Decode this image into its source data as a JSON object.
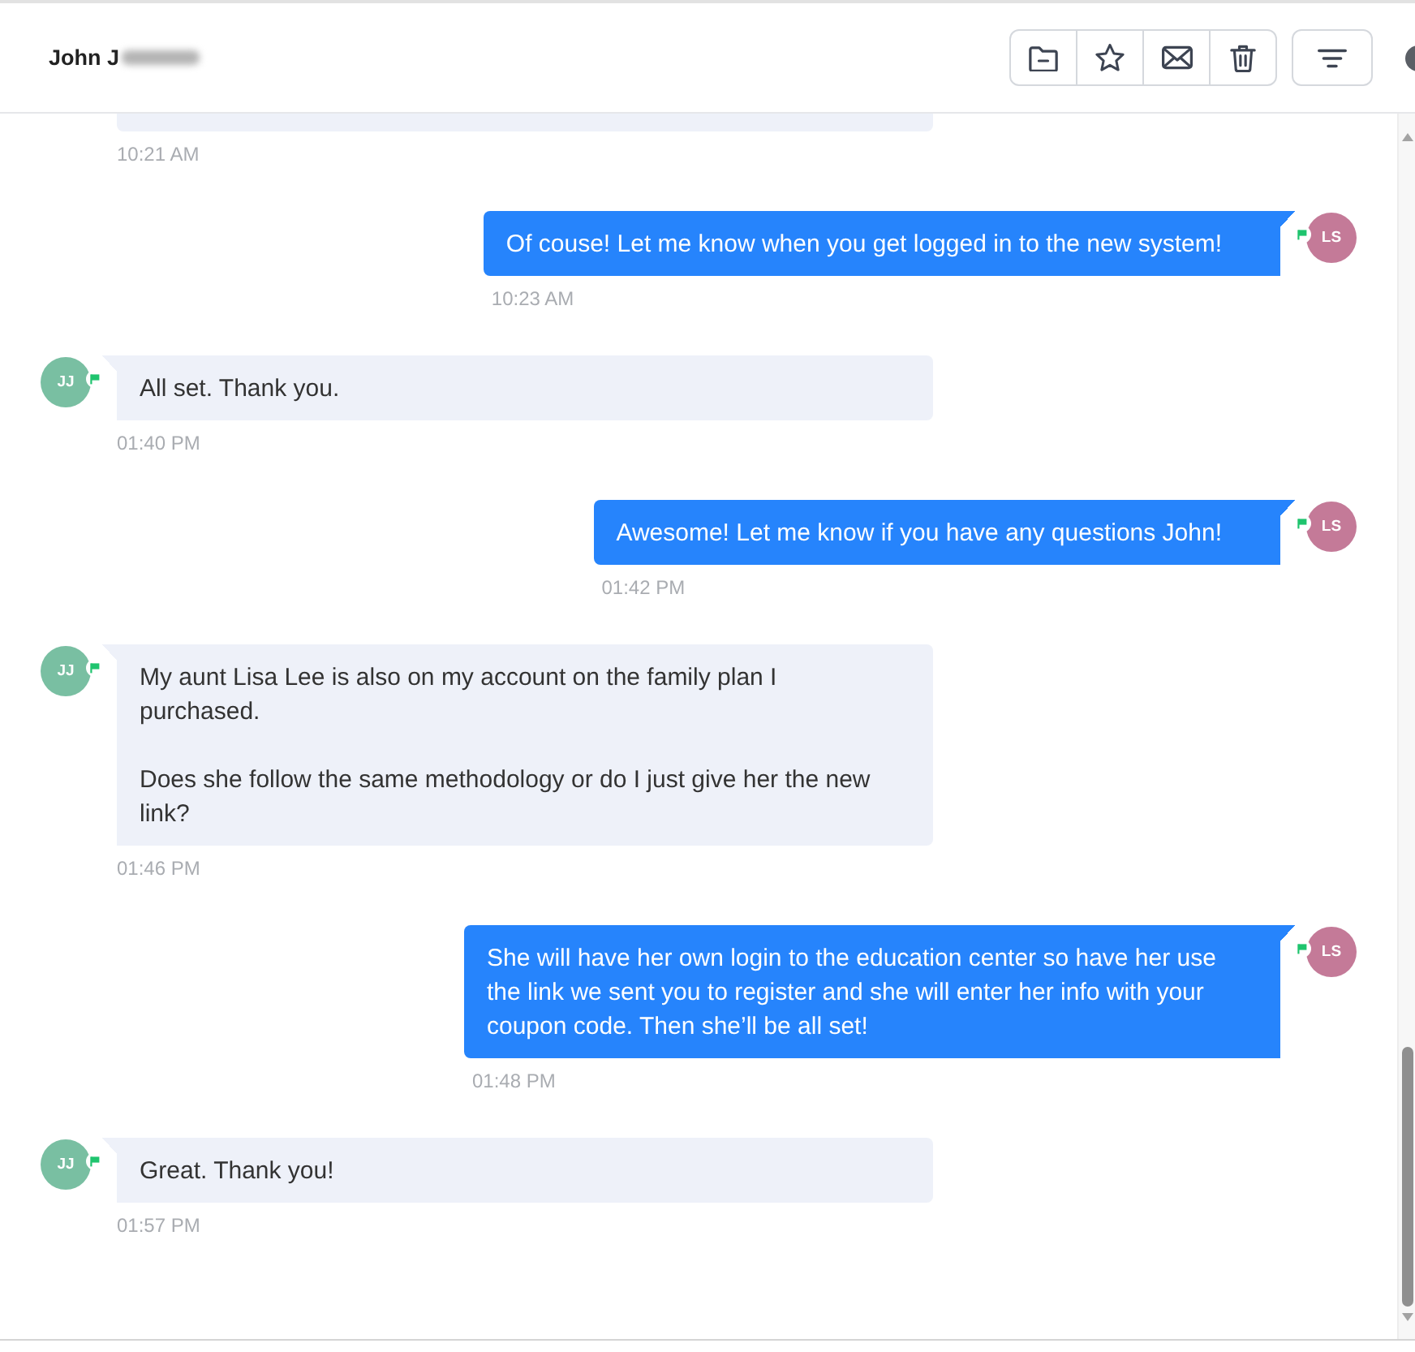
{
  "header": {
    "title": "John J",
    "title_redacted": true
  },
  "messages": [
    {
      "kind": "incoming",
      "partial": true,
      "time": "10:21 AM"
    },
    {
      "kind": "outgoing",
      "partial": false,
      "sender": {
        "initials": "LS",
        "color": "#c47a98",
        "flagged": true
      },
      "paragraphs": [
        "Of couse! Let me know when you get logged in to the new system!"
      ],
      "time": "10:23 AM"
    },
    {
      "kind": "incoming",
      "partial": false,
      "sender": {
        "initials": "JJ",
        "color": "#79bfa2",
        "flagged": true
      },
      "paragraphs": [
        "All set. Thank you."
      ],
      "time": "01:40 PM"
    },
    {
      "kind": "outgoing",
      "partial": false,
      "sender": {
        "initials": "LS",
        "color": "#c47a98",
        "flagged": true
      },
      "paragraphs": [
        "Awesome! Let me know if you have any questions John!"
      ],
      "time": "01:42 PM"
    },
    {
      "kind": "incoming",
      "partial": false,
      "sender": {
        "initials": "JJ",
        "color": "#79bfa2",
        "flagged": true
      },
      "paragraphs": [
        "My aunt Lisa Lee is also on my account on the family plan I purchased.",
        "Does she follow the same methodology or do I just give her the new link?"
      ],
      "time": "01:46 PM"
    },
    {
      "kind": "outgoing",
      "partial": false,
      "sender": {
        "initials": "LS",
        "color": "#c47a98",
        "flagged": true
      },
      "paragraphs": [
        "She will have her own login to the education center so have her use the link we sent you to register and she will enter her info with your coupon code. Then she’ll be all set!"
      ],
      "time": "01:48 PM"
    },
    {
      "kind": "incoming",
      "partial": false,
      "sender": {
        "initials": "JJ",
        "color": "#79bfa2",
        "flagged": true
      },
      "paragraphs": [
        "Great. Thank you!"
      ],
      "time": "01:57 PM"
    }
  ]
}
